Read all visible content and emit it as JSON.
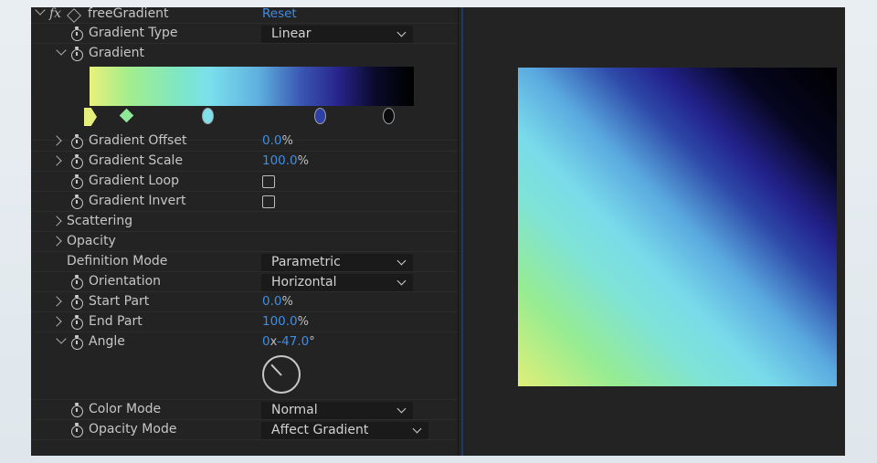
{
  "effect": {
    "name": "freeGradient",
    "fx_label": "fx",
    "reset_label": "Reset"
  },
  "rows": {
    "gradient_type": {
      "label": "Gradient Type",
      "value": "Linear"
    },
    "gradient": {
      "label": "Gradient"
    },
    "gradient_offset": {
      "label": "Gradient Offset",
      "value": "0.0",
      "unit": "%"
    },
    "gradient_scale": {
      "label": "Gradient Scale",
      "value": "100.0",
      "unit": "%"
    },
    "gradient_loop": {
      "label": "Gradient Loop"
    },
    "gradient_invert": {
      "label": "Gradient Invert"
    },
    "scattering": {
      "label": "Scattering"
    },
    "opacity": {
      "label": "Opacity"
    },
    "definition_mode": {
      "label": "Definition Mode",
      "value": "Parametric"
    },
    "orientation": {
      "label": "Orientation",
      "value": "Horizontal"
    },
    "start_part": {
      "label": "Start Part",
      "value": "0.0",
      "unit": "%"
    },
    "end_part": {
      "label": "End Part",
      "value": "100.0",
      "unit": "%"
    },
    "angle": {
      "label": "Angle",
      "revolutions": "0",
      "x_label": "x",
      "degrees": "-47.0",
      "unit": "°"
    },
    "color_mode": {
      "label": "Color Mode",
      "value": "Normal"
    },
    "opacity_mode": {
      "label": "Opacity Mode",
      "value": "Affect Gradient"
    }
  },
  "gradient_stops": [
    {
      "color": "#e6ef7c",
      "shape": "flag"
    },
    {
      "color": "#8fe89a",
      "shape": "diamond"
    },
    {
      "color": "#7fe0ec",
      "shape": "round"
    },
    {
      "color": "#2f3fa6",
      "shape": "round"
    },
    {
      "color": "#0a0a0a",
      "shape": "round"
    }
  ],
  "colors": {
    "accent": "#3d8ee6",
    "panel_bg": "#232323"
  }
}
